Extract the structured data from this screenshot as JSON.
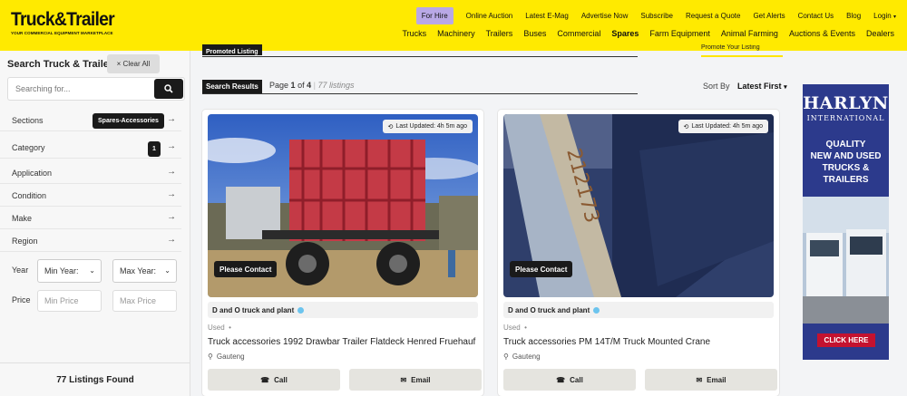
{
  "header": {
    "logo_main": "Truck&Trailer",
    "logo_sub": "YOUR COMMERCIAL EQUIPMENT MARKETPLACE",
    "top_links": [
      "For Hire",
      "Online Auction",
      "Latest E-Mag",
      "Advertise Now",
      "Subscribe",
      "Request a Quote",
      "Get Alerts",
      "Contact Us",
      "Blog",
      "Login"
    ],
    "main_links": [
      "Trucks",
      "Machinery",
      "Trailers",
      "Buses",
      "Commercial",
      "Spares",
      "Farm Equipment",
      "Animal Farming",
      "Auctions & Events",
      "Dealers"
    ],
    "active_main": "Spares"
  },
  "sidebar": {
    "title": "Search Truck & Trailer",
    "clear_label": "× Clear All",
    "search_placeholder": "Searching for...",
    "filters": {
      "sections": "Sections",
      "sections_value": "Spares-Accessories",
      "category": "Category",
      "category_count": "1",
      "application": "Application",
      "condition": "Condition",
      "make": "Make",
      "region": "Region"
    },
    "year_label": "Year",
    "min_year": "Min Year:",
    "max_year": "Max Year:",
    "price_label": "Price",
    "min_price": "Min Price",
    "max_price": "Max Price",
    "found": "77 Listings Found"
  },
  "main": {
    "promoted_tab": "Promoted Listing",
    "promote_yours": "Promote Your Listing",
    "results_tab": "Search Results",
    "page_prefix": "Page",
    "page_current": "1",
    "page_of": "of",
    "page_total": "4",
    "listings_count": "77 listings",
    "sort_label": "Sort By",
    "sort_value": "Latest First"
  },
  "listings": [
    {
      "updated": "Last Updated: 4h 5m ago",
      "price": "Please Contact",
      "dealer": "D and O truck and plant",
      "condition": "Used",
      "title": "Truck accessories 1992 Drawbar Trailer Flatdeck Henred Fruehauf",
      "location": "Gauteng",
      "call": "Call",
      "email": "Email"
    },
    {
      "updated": "Last Updated: 4h 5m ago",
      "price": "Please Contact",
      "dealer": "D and O truck and plant",
      "condition": "Used",
      "title": "Truck accessories PM 14T/M Truck Mounted Crane",
      "location": "Gauteng",
      "call": "Call",
      "email": "Email"
    }
  ],
  "ad": {
    "brand": "HARLYN",
    "brand_sub": "INTERNATIONAL",
    "tagline_1": "QUALITY",
    "tagline_2": "NEW AND USED",
    "tagline_3": "TRUCKS &",
    "tagline_4": "TRAILERS",
    "cta": "CLICK HERE"
  },
  "colors": {
    "header_bg": "#ffea00",
    "for_hire_bg": "#b9a8e6",
    "ad_bg": "#2c3a8c",
    "ad_cta": "#c4122f"
  }
}
